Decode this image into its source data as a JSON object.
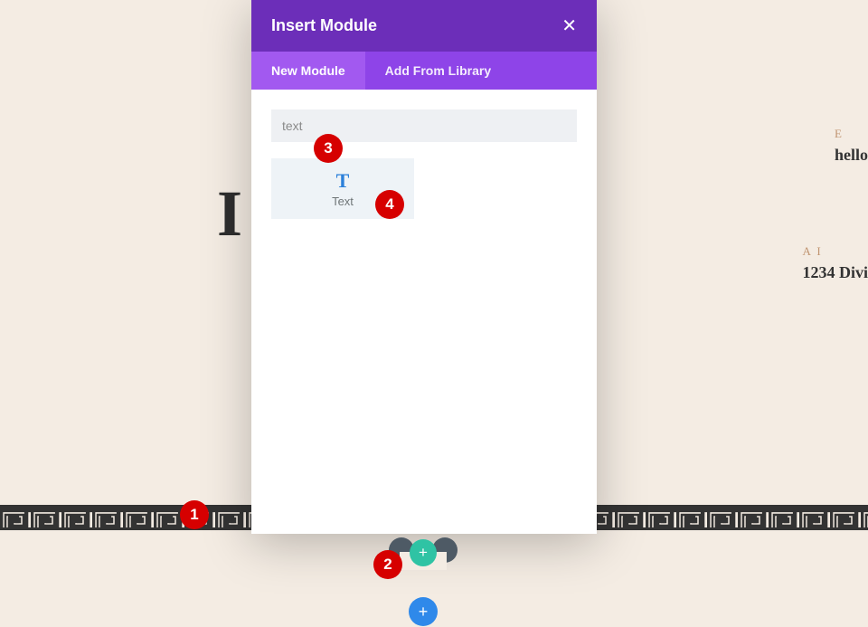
{
  "background": {
    "heading_partial": "I                             n",
    "right1_label": "E",
    "right1_value": "hello",
    "right2_label": "A   I",
    "right2_value": "1234 Divi"
  },
  "modal": {
    "title": "Insert Module",
    "tabs": {
      "new": "New Module",
      "library": "Add From Library"
    },
    "search_value": "text",
    "module_text_label": "Text",
    "module_text_icon": "T"
  },
  "buttons": {
    "add_teal": "+",
    "add_blue": "+"
  },
  "callouts": {
    "b1": "1",
    "b2": "2",
    "b3": "3",
    "b4": "4"
  }
}
